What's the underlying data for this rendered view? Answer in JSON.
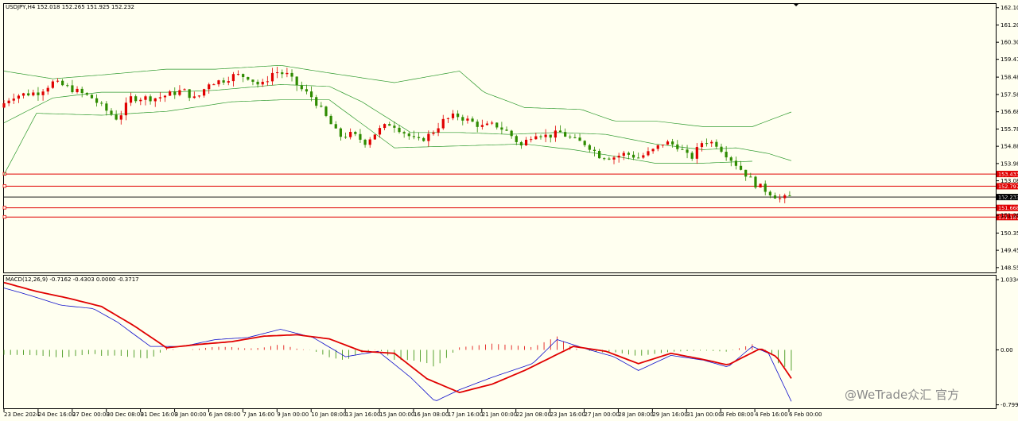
{
  "chart_data": {
    "type": "candlestick",
    "symbol_header": "USDJPY,H4  152.018 152.265 151.925 152.232",
    "price_axis": {
      "range": [
        148.3,
        162.3
      ],
      "ticks": [
        "162.105",
        "161.205",
        "160.305",
        "159.415",
        "158.485",
        "157.580",
        "156.680",
        "155.780",
        "154.880",
        "153.980",
        "153.080",
        "152.180",
        "151.280",
        "150.355",
        "149.455",
        "148.555"
      ]
    },
    "current_price": "152.232",
    "horizontal_levels": [
      {
        "value": 153.433,
        "label": "153.433",
        "color": "#e00000"
      },
      {
        "value": 152.797,
        "label": "152.797",
        "color": "#e00000"
      },
      {
        "value": 151.668,
        "label": "151.668",
        "color": "#e00000"
      },
      {
        "value": 151.187,
        "label": "151.187",
        "color": "#e00000"
      }
    ],
    "time_labels": [
      "23 Dec 2024",
      "24 Dec 16:00",
      "27 Dec 00:00",
      "30 Dec 08:00",
      "31 Dec 16:00",
      "3 Jan 00:00",
      "6 Jan 08:00",
      "7 Jan 16:00",
      "9 Jan 00:00",
      "10 Jan 08:00",
      "13 Jan 16:00",
      "15 Jan 00:00",
      "16 Jan 08:00",
      "17 Jan 16:00",
      "21 Jan 00:00",
      "22 Jan 08:00",
      "23 Jan 16:00",
      "27 Jan 00:00",
      "28 Jan 08:00",
      "29 Jan 16:00",
      "31 Jan 00:00",
      "3 Feb 08:00",
      "4 Feb 16:00",
      "6 Feb 00:00"
    ],
    "close_path": [
      [
        0,
        156.9
      ],
      [
        8,
        157.5
      ],
      [
        16,
        157.6
      ],
      [
        24,
        157.7
      ],
      [
        33,
        158.2
      ],
      [
        41,
        158.0
      ],
      [
        49,
        157.7
      ],
      [
        57,
        157.4
      ],
      [
        65,
        156.8
      ],
      [
        73,
        156.3
      ],
      [
        81,
        157.4
      ],
      [
        89,
        157.4
      ],
      [
        97,
        157.4
      ],
      [
        105,
        157.6
      ],
      [
        113,
        157.8
      ],
      [
        121,
        157.3
      ],
      [
        129,
        158.2
      ],
      [
        137,
        158.3
      ],
      [
        145,
        158.6
      ],
      [
        153,
        158.5
      ],
      [
        161,
        158.0
      ],
      [
        169,
        158.8
      ],
      [
        177,
        158.6
      ],
      [
        185,
        157.9
      ],
      [
        193,
        157.4
      ],
      [
        201,
        156.4
      ],
      [
        209,
        155.4
      ],
      [
        217,
        155.5
      ],
      [
        225,
        155.1
      ],
      [
        233,
        155.7
      ],
      [
        241,
        156.1
      ],
      [
        249,
        155.6
      ],
      [
        257,
        155.1
      ],
      [
        265,
        155.5
      ],
      [
        273,
        156.2
      ],
      [
        281,
        156.5
      ],
      [
        289,
        156.2
      ],
      [
        297,
        155.9
      ],
      [
        305,
        156.0
      ],
      [
        313,
        155.6
      ],
      [
        321,
        154.9
      ],
      [
        329,
        155.6
      ],
      [
        337,
        155.4
      ],
      [
        345,
        155.6
      ],
      [
        353,
        155.2
      ],
      [
        361,
        155.0
      ],
      [
        369,
        154.4
      ],
      [
        377,
        154.3
      ],
      [
        385,
        154.5
      ],
      [
        393,
        154.3
      ],
      [
        401,
        154.6
      ],
      [
        409,
        155.1
      ],
      [
        417,
        154.9
      ],
      [
        425,
        154.2
      ],
      [
        433,
        155.2
      ],
      [
        441,
        155.0
      ],
      [
        449,
        154.3
      ],
      [
        457,
        153.6
      ],
      [
        465,
        152.9
      ],
      [
        473,
        152.5
      ],
      [
        481,
        152.1
      ],
      [
        485,
        152.23
      ]
    ],
    "bollinger": {
      "upper": [
        [
          0,
          158.8
        ],
        [
          30,
          158.4
        ],
        [
          60,
          158.6
        ],
        [
          100,
          158.9
        ],
        [
          130,
          158.9
        ],
        [
          170,
          159.1
        ],
        [
          200,
          158.7
        ],
        [
          240,
          158.2
        ],
        [
          280,
          158.8
        ],
        [
          295,
          157.7
        ],
        [
          320,
          156.9
        ],
        [
          355,
          156.8
        ],
        [
          375,
          156.2
        ],
        [
          400,
          156.2
        ],
        [
          430,
          155.9
        ],
        [
          460,
          155.9
        ],
        [
          485,
          156.7
        ]
      ],
      "mid": [
        [
          0,
          156.1
        ],
        [
          30,
          157.4
        ],
        [
          60,
          157.7
        ],
        [
          100,
          157.7
        ],
        [
          130,
          157.8
        ],
        [
          170,
          158.1
        ],
        [
          200,
          158.0
        ],
        [
          220,
          157.2
        ],
        [
          250,
          155.6
        ],
        [
          280,
          155.6
        ],
        [
          310,
          155.5
        ],
        [
          340,
          155.6
        ],
        [
          370,
          155.5
        ],
        [
          400,
          155.0
        ],
        [
          430,
          154.7
        ],
        [
          450,
          154.8
        ],
        [
          470,
          154.5
        ],
        [
          485,
          154.1
        ]
      ],
      "lower": [
        [
          0,
          153.4
        ],
        [
          20,
          156.6
        ],
        [
          60,
          156.5
        ],
        [
          100,
          156.7
        ],
        [
          140,
          157.2
        ],
        [
          170,
          157.3
        ],
        [
          200,
          157.3
        ],
        [
          240,
          154.8
        ],
        [
          280,
          154.9
        ],
        [
          320,
          155.0
        ],
        [
          350,
          154.7
        ],
        [
          380,
          154.3
        ],
        [
          400,
          154.0
        ],
        [
          430,
          154.0
        ],
        [
          460,
          154.1
        ]
      ]
    },
    "macd": {
      "header": "MACD(12,26,9) -0.7162 -0.4303 0.0000 -0.3717",
      "range": [
        -0.85,
        1.08
      ],
      "ticks": [
        "1.0334",
        "0.00",
        "-0.7995"
      ],
      "signal_color": "#e00000",
      "macd_color": "#1010cc",
      "hist_up_color": "#e00000",
      "hist_down_color": "#2e8b00",
      "signal": [
        [
          0,
          0.98
        ],
        [
          20,
          0.85
        ],
        [
          40,
          0.75
        ],
        [
          60,
          0.63
        ],
        [
          80,
          0.35
        ],
        [
          100,
          0.03
        ],
        [
          120,
          0.08
        ],
        [
          140,
          0.12
        ],
        [
          160,
          0.2
        ],
        [
          180,
          0.22
        ],
        [
          200,
          0.16
        ],
        [
          220,
          -0.02
        ],
        [
          240,
          -0.05
        ],
        [
          260,
          -0.42
        ],
        [
          280,
          -0.62
        ],
        [
          300,
          -0.5
        ],
        [
          320,
          -0.3
        ],
        [
          350,
          0.05
        ],
        [
          370,
          -0.02
        ],
        [
          390,
          -0.2
        ],
        [
          410,
          -0.05
        ],
        [
          430,
          -0.14
        ],
        [
          445,
          -0.22
        ],
        [
          465,
          0.02
        ],
        [
          475,
          -0.1
        ],
        [
          485,
          -0.45
        ]
      ],
      "main": [
        [
          0,
          0.9
        ],
        [
          15,
          0.8
        ],
        [
          35,
          0.65
        ],
        [
          55,
          0.6
        ],
        [
          70,
          0.4
        ],
        [
          90,
          0.05
        ],
        [
          110,
          0.05
        ],
        [
          130,
          0.15
        ],
        [
          150,
          0.18
        ],
        [
          170,
          0.3
        ],
        [
          190,
          0.18
        ],
        [
          210,
          -0.1
        ],
        [
          230,
          -0.02
        ],
        [
          250,
          -0.4
        ],
        [
          265,
          -0.75
        ],
        [
          280,
          -0.58
        ],
        [
          300,
          -0.4
        ],
        [
          325,
          -0.2
        ],
        [
          340,
          0.15
        ],
        [
          360,
          0.0
        ],
        [
          375,
          -0.1
        ],
        [
          390,
          -0.3
        ],
        [
          410,
          -0.08
        ],
        [
          430,
          -0.15
        ],
        [
          445,
          -0.25
        ],
        [
          460,
          0.05
        ],
        [
          470,
          -0.05
        ],
        [
          485,
          -0.8
        ]
      ]
    }
  },
  "watermark": "@WeTrade众汇 官方"
}
